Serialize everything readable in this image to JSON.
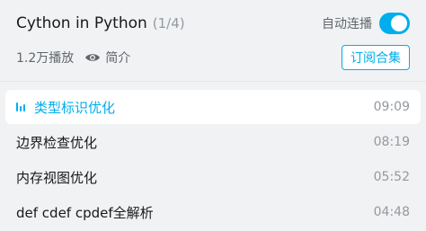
{
  "header": {
    "title": "Cython in Python",
    "count": "(1/4)",
    "autoplay_label": "自动连播",
    "autoplay_on": true
  },
  "meta": {
    "plays": "1.2万播放",
    "intro_label": "简介",
    "subscribe_label": "订阅合集"
  },
  "colors": {
    "accent": "#00aeec",
    "background": "#f1f2f3",
    "text": "#18191c",
    "muted": "#9499a0"
  },
  "icons": {
    "intro": "eye-icon",
    "playing": "playing-bars-icon"
  },
  "playlist": [
    {
      "title": "类型标识优化",
      "duration": "09:09",
      "active": true
    },
    {
      "title": "边界检查优化",
      "duration": "08:19",
      "active": false
    },
    {
      "title": "内存视图优化",
      "duration": "05:52",
      "active": false
    },
    {
      "title": "def cdef cpdef全解析",
      "duration": "04:48",
      "active": false
    }
  ]
}
